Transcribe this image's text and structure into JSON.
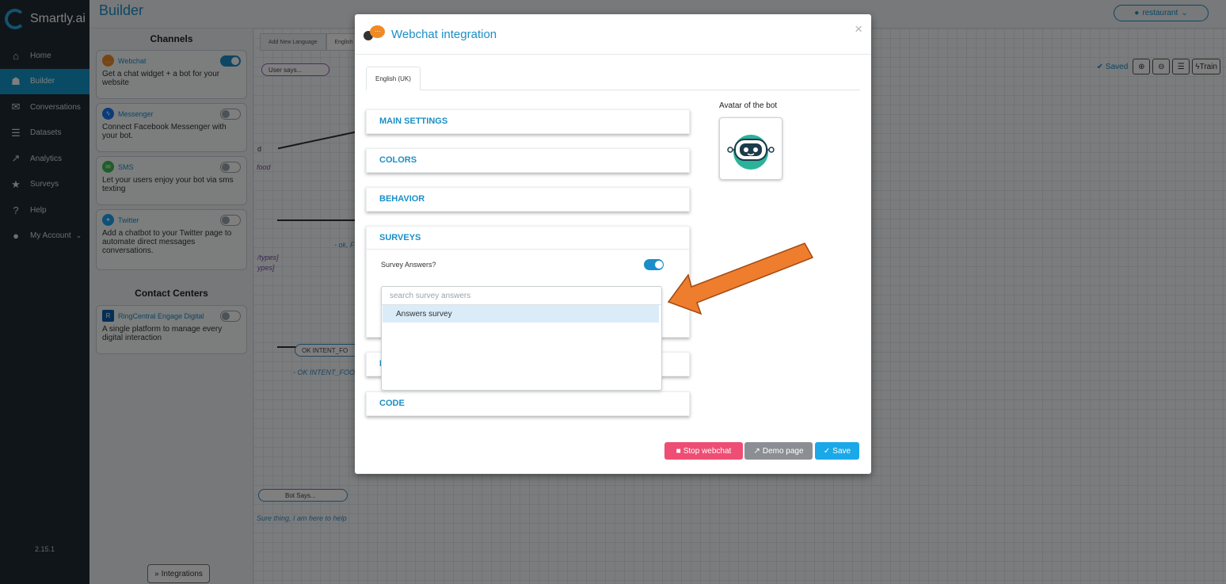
{
  "brand": {
    "name": "Smartly.ai"
  },
  "nav": {
    "items": [
      {
        "label": "Home",
        "icon": "home-icon"
      },
      {
        "label": "Builder",
        "icon": "sitemap-icon"
      },
      {
        "label": "Conversations",
        "icon": "comments-icon"
      },
      {
        "label": "Datasets",
        "icon": "database-icon"
      },
      {
        "label": "Analytics",
        "icon": "line-chart-icon"
      },
      {
        "label": "Surveys",
        "icon": "star-icon"
      },
      {
        "label": "Help",
        "icon": "question-icon"
      },
      {
        "label": "My Account",
        "icon": "user-icon"
      }
    ],
    "active": "Builder",
    "version": "2.15.1"
  },
  "topbar": {
    "title": "Builder",
    "bot_name": "restaurant"
  },
  "channels": {
    "heading": "Channels",
    "items": [
      {
        "name": "Webchat",
        "desc": "Get a chat widget + a bot for your website",
        "enabled": true
      },
      {
        "name": "Messenger",
        "desc": "Connect Facebook Messenger with your bot.",
        "enabled": false
      },
      {
        "name": "SMS",
        "desc": "Let your users enjoy your bot via sms texting",
        "enabled": false
      },
      {
        "name": "Twitter",
        "desc": "Add a chatbot to your Twitter page to automate direct messages conversations.",
        "enabled": false
      }
    ],
    "contact_heading": "Contact Centers",
    "contact_items": [
      {
        "name": "RingCentral Engage Digital",
        "desc": "A single platform to manage every digital interaction",
        "enabled": false
      }
    ],
    "integrations_label": "Integrations"
  },
  "canvas": {
    "tabs": [
      "Add New Language",
      "English"
    ],
    "saved_label": "Saved",
    "train_label": "Train",
    "nodes": {
      "user_says": "User says...",
      "ok_intent": "OK INTENT_FO",
      "bot_says": "Bot Says..."
    },
    "texts": {
      "food": "food",
      "d": "d",
      "ok_f": "- ok, F",
      "types1": "/types]",
      "types2": "ypes]",
      "ok_intent_text": "- OK INTENT_FOO",
      "sure": "Sure thing, I am here to help"
    }
  },
  "modal": {
    "title": "Webchat integration",
    "lang_tab": "English (UK)",
    "sections": {
      "main": "MAIN SETTINGS",
      "colors": "COLORS",
      "behavior": "BEHAVIOR",
      "surveys": "SURVEYS",
      "hidden_d": "D",
      "code": "CODE"
    },
    "survey_answers_label": "Survey Answers?",
    "survey_answers_enabled": true,
    "search_placeholder": "search survey answers",
    "options": [
      "Answers survey"
    ],
    "avatar_label": "Avatar of the bot",
    "buttons": {
      "stop": "Stop webchat",
      "demo": "Demo page",
      "save": "Save"
    }
  },
  "colors": {
    "accent": "#1a8fc7",
    "arrow": "#ef7d2e",
    "stop": "#ee4e73",
    "save": "#1aa8e8"
  }
}
